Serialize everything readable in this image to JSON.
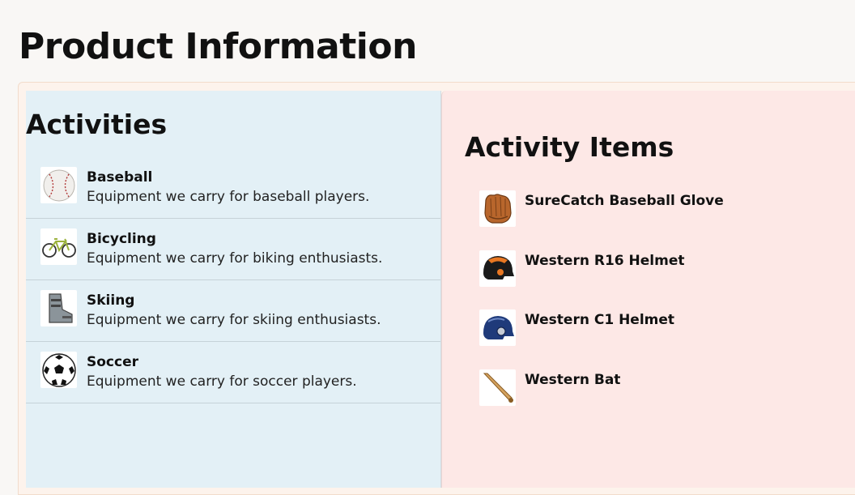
{
  "page": {
    "title": "Product Information"
  },
  "activities": {
    "heading": "Activities",
    "items": [
      {
        "name": "Baseball",
        "description": "Equipment we carry for baseball players.",
        "icon": "baseball-icon"
      },
      {
        "name": "Bicycling",
        "description": "Equipment we carry for biking enthusiasts.",
        "icon": "bicycle-icon"
      },
      {
        "name": "Skiing",
        "description": "Equipment we carry for skiing enthusiasts.",
        "icon": "ski-boot-icon"
      },
      {
        "name": "Soccer",
        "description": "Equipment we carry for soccer players.",
        "icon": "soccer-ball-icon"
      }
    ]
  },
  "activity_items": {
    "heading": "Activity Items",
    "items": [
      {
        "name": "SureCatch Baseball Glove",
        "icon": "baseball-glove-icon"
      },
      {
        "name": "Western R16 Helmet",
        "icon": "batting-helmet-orange-icon"
      },
      {
        "name": "Western C1 Helmet",
        "icon": "batting-helmet-blue-icon"
      },
      {
        "name": "Western Bat",
        "icon": "baseball-bat-icon"
      }
    ]
  }
}
